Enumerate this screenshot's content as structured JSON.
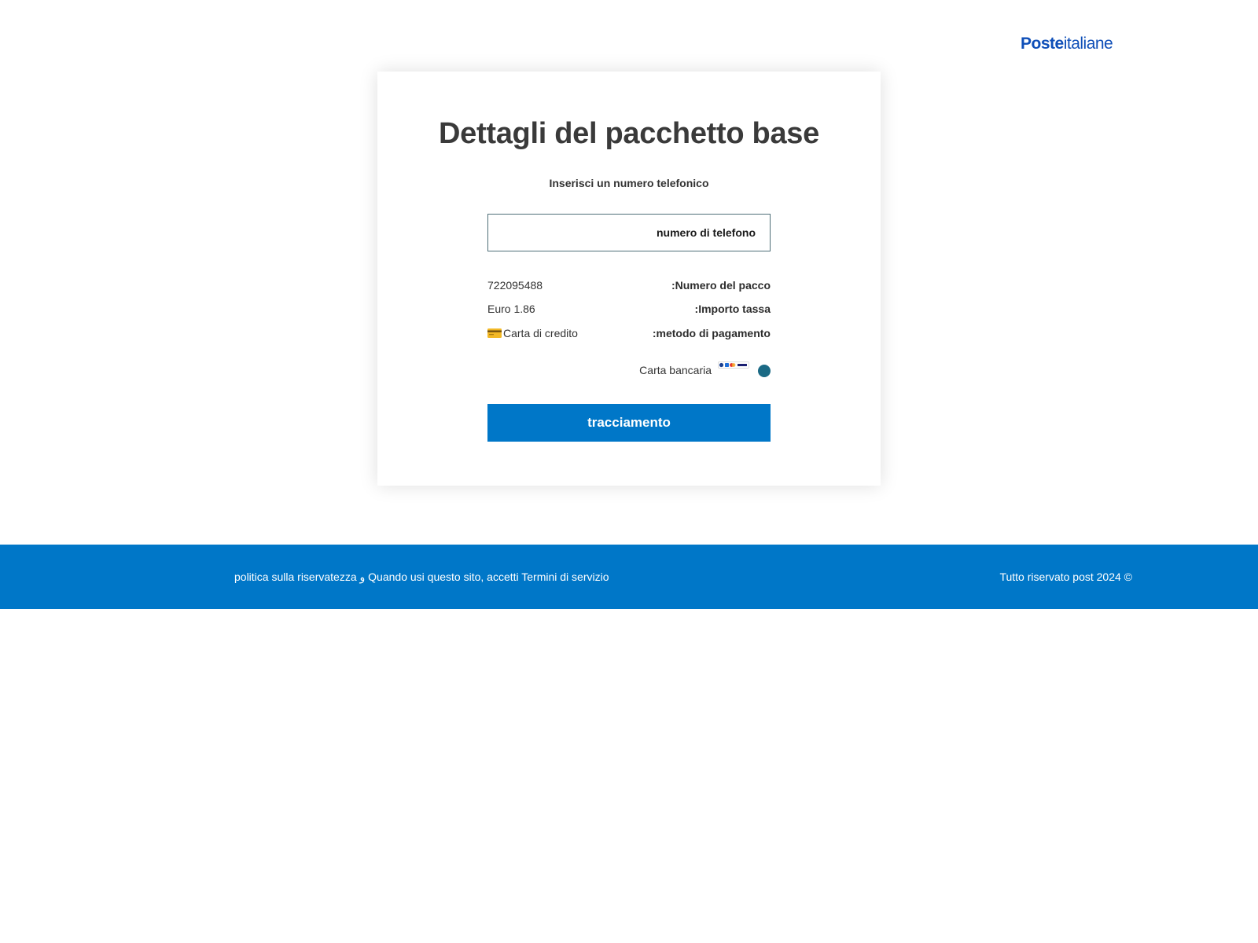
{
  "header": {
    "logo_bold": "Poste",
    "logo_light": "italiane"
  },
  "form": {
    "title": "Dettagli del pacchetto base",
    "subtitle": "Inserisci un numero telefonico",
    "phone_placeholder": "numero di telefono",
    "phone_value": "",
    "details": [
      {
        "label": ":Numero del pacco",
        "value": "722095488"
      },
      {
        "label": ":Importo tassa",
        "value": "Euro 1.86"
      },
      {
        "label": ":metodo di pagamento",
        "value": "Carta di credito",
        "icon": "credit-card-icon"
      }
    ],
    "payment_option": {
      "label": "Carta bancaria",
      "selected": true,
      "brands_icon": "card-brands-icon"
    },
    "submit_label": "tracciamento"
  },
  "footer": {
    "left_text_1": "politica sulla riservatezza",
    "separator": "و",
    "left_text_2": "Quando usi questo sito, accetti",
    "terms_label": "Termini di servizio",
    "right_text": "Tutto riservato post 2024 ©"
  },
  "colors": {
    "primary_blue": "#0077c8",
    "logo_blue": "#0f4fb8",
    "radio_teal": "#1b6a85",
    "input_border": "#4f6f78"
  }
}
